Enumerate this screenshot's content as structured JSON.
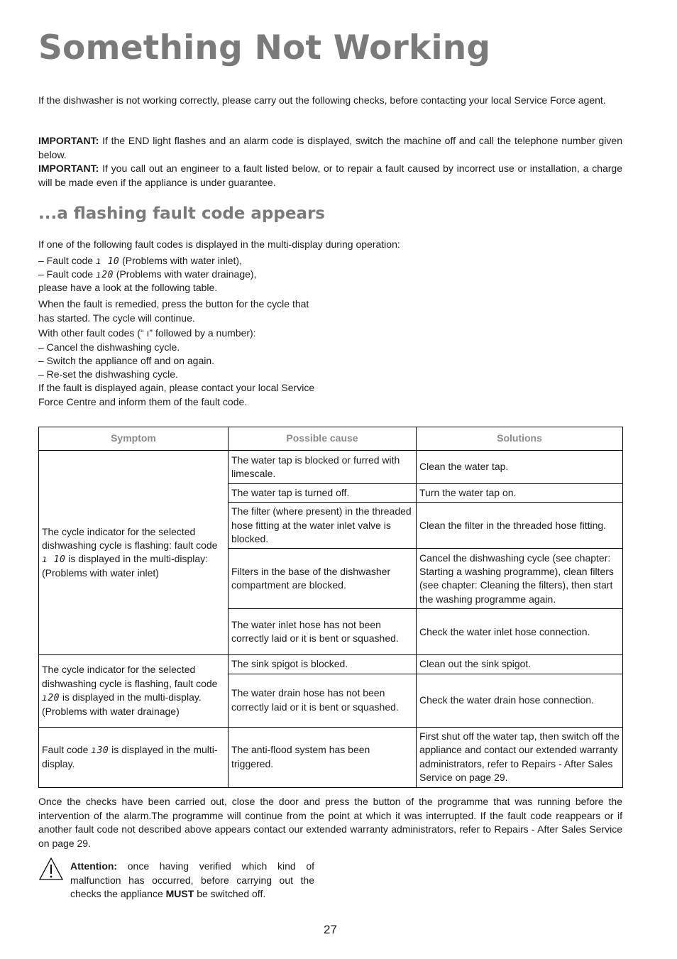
{
  "page": {
    "title": "Something Not Working",
    "intro": "If the dishwasher is not working correctly, please carry out the following checks, before contacting your local Service Force agent.",
    "important1_label": "IMPORTANT:",
    "important1_text": " If the END light flashes and an alarm code is displayed, switch the machine off and call the telephone number given below.",
    "important2_label": "IMPORTANT:",
    "important2_text": " If you call out an engineer to a fault listed below, or to repair a fault caused by incorrect use or installation, a charge will be made even if the appliance is under guarantee.",
    "section_title": "...a flashing fault code appears",
    "section_intro": "If one of the following fault codes is displayed in the multi-display during operation:",
    "fault_list": [
      {
        "prefix": "– Fault code ",
        "code": "ı 10",
        "suffix": " (Problems with water inlet),"
      },
      {
        "prefix": "– Fault code ",
        "code": "ı20",
        "suffix": " (Problems with water drainage),"
      }
    ],
    "look_table": "please have a look at the following table.",
    "remedied": "When the fault is remedied, press the button for the cycle that has started. The cycle will continue.",
    "other_codes": "With other fault codes (“ ı” followed by a number):",
    "steps": [
      "– Cancel the dishwashing cycle.",
      "– Switch the appliance off and on again.",
      "– Re-set the dishwashing cycle."
    ],
    "if_again": "If the fault is displayed again, please contact your local Service Force Centre and inform them of the fault code.",
    "table": {
      "headers": [
        "Symptom",
        "Possible cause",
        "Solutions"
      ],
      "group1": {
        "symptom_a": "The cycle indicator for the selected dishwashing cycle is flashing: fault code ",
        "symptom_code": "ı 10",
        "symptom_b": " is displayed in the multi-display: (Problems with water inlet)",
        "rows": [
          {
            "cause": "The water tap is blocked or furred with limescale.",
            "solution": "Clean the water tap."
          },
          {
            "cause": "The water tap is turned off.",
            "solution": "Turn the water tap on."
          },
          {
            "cause": "The filter (where present) in the threaded hose fitting at the water inlet valve is blocked.",
            "solution": "Clean the filter in the threaded hose fitting."
          },
          {
            "cause": "Filters in the base of the dishwasher compartment are blocked.",
            "solution": "Cancel the dishwashing cycle (see chapter: Starting a washing programme), clean filters (see chapter: Cleaning the filters), then start the washing programme again."
          },
          {
            "cause": "The water inlet hose has not been correctly laid or it is bent or squashed.",
            "solution": "Check the water inlet hose connection."
          }
        ]
      },
      "group2": {
        "symptom_a": "The cycle indicator for the selected dishwashing cycle is flashing, fault code ",
        "symptom_code": "ı20",
        "symptom_b": " is displayed in the multi-display. (Problems with water drainage)",
        "rows": [
          {
            "cause": "The sink spigot is blocked.",
            "solution": "Clean out the sink spigot."
          },
          {
            "cause": "The water drain hose has not been correctly laid or it is bent or squashed.",
            "solution": "Check the water drain hose connection."
          }
        ]
      },
      "group3": {
        "symptom_a": "Fault code ",
        "symptom_code": "ı30",
        "symptom_b": " is displayed in the multi-display.",
        "rows": [
          {
            "cause": "The anti-flood system has been triggered.",
            "solution": "First shut off the water tap, then switch off the appliance and contact our extended warranty administrators, refer to Repairs - After Sales Service on page 29."
          }
        ]
      }
    },
    "after_table": "Once the checks have been carried out, close the door and press the button of the programme that was running before the intervention of the alarm.The programme will continue from the point at which it was interrupted. If the fault code reappears or if another fault code not described above appears contact our extended warranty administrators, refer to Repairs - After Sales Service on page 29.",
    "attention_label": "Attention:",
    "attention_a": " once having verified which kind of malfunction has occurred, before carrying out the checks the appliance ",
    "attention_must": "MUST",
    "attention_b": " be switched off.",
    "page_number": "27",
    "warning_icon": "warning-triangle-icon"
  }
}
